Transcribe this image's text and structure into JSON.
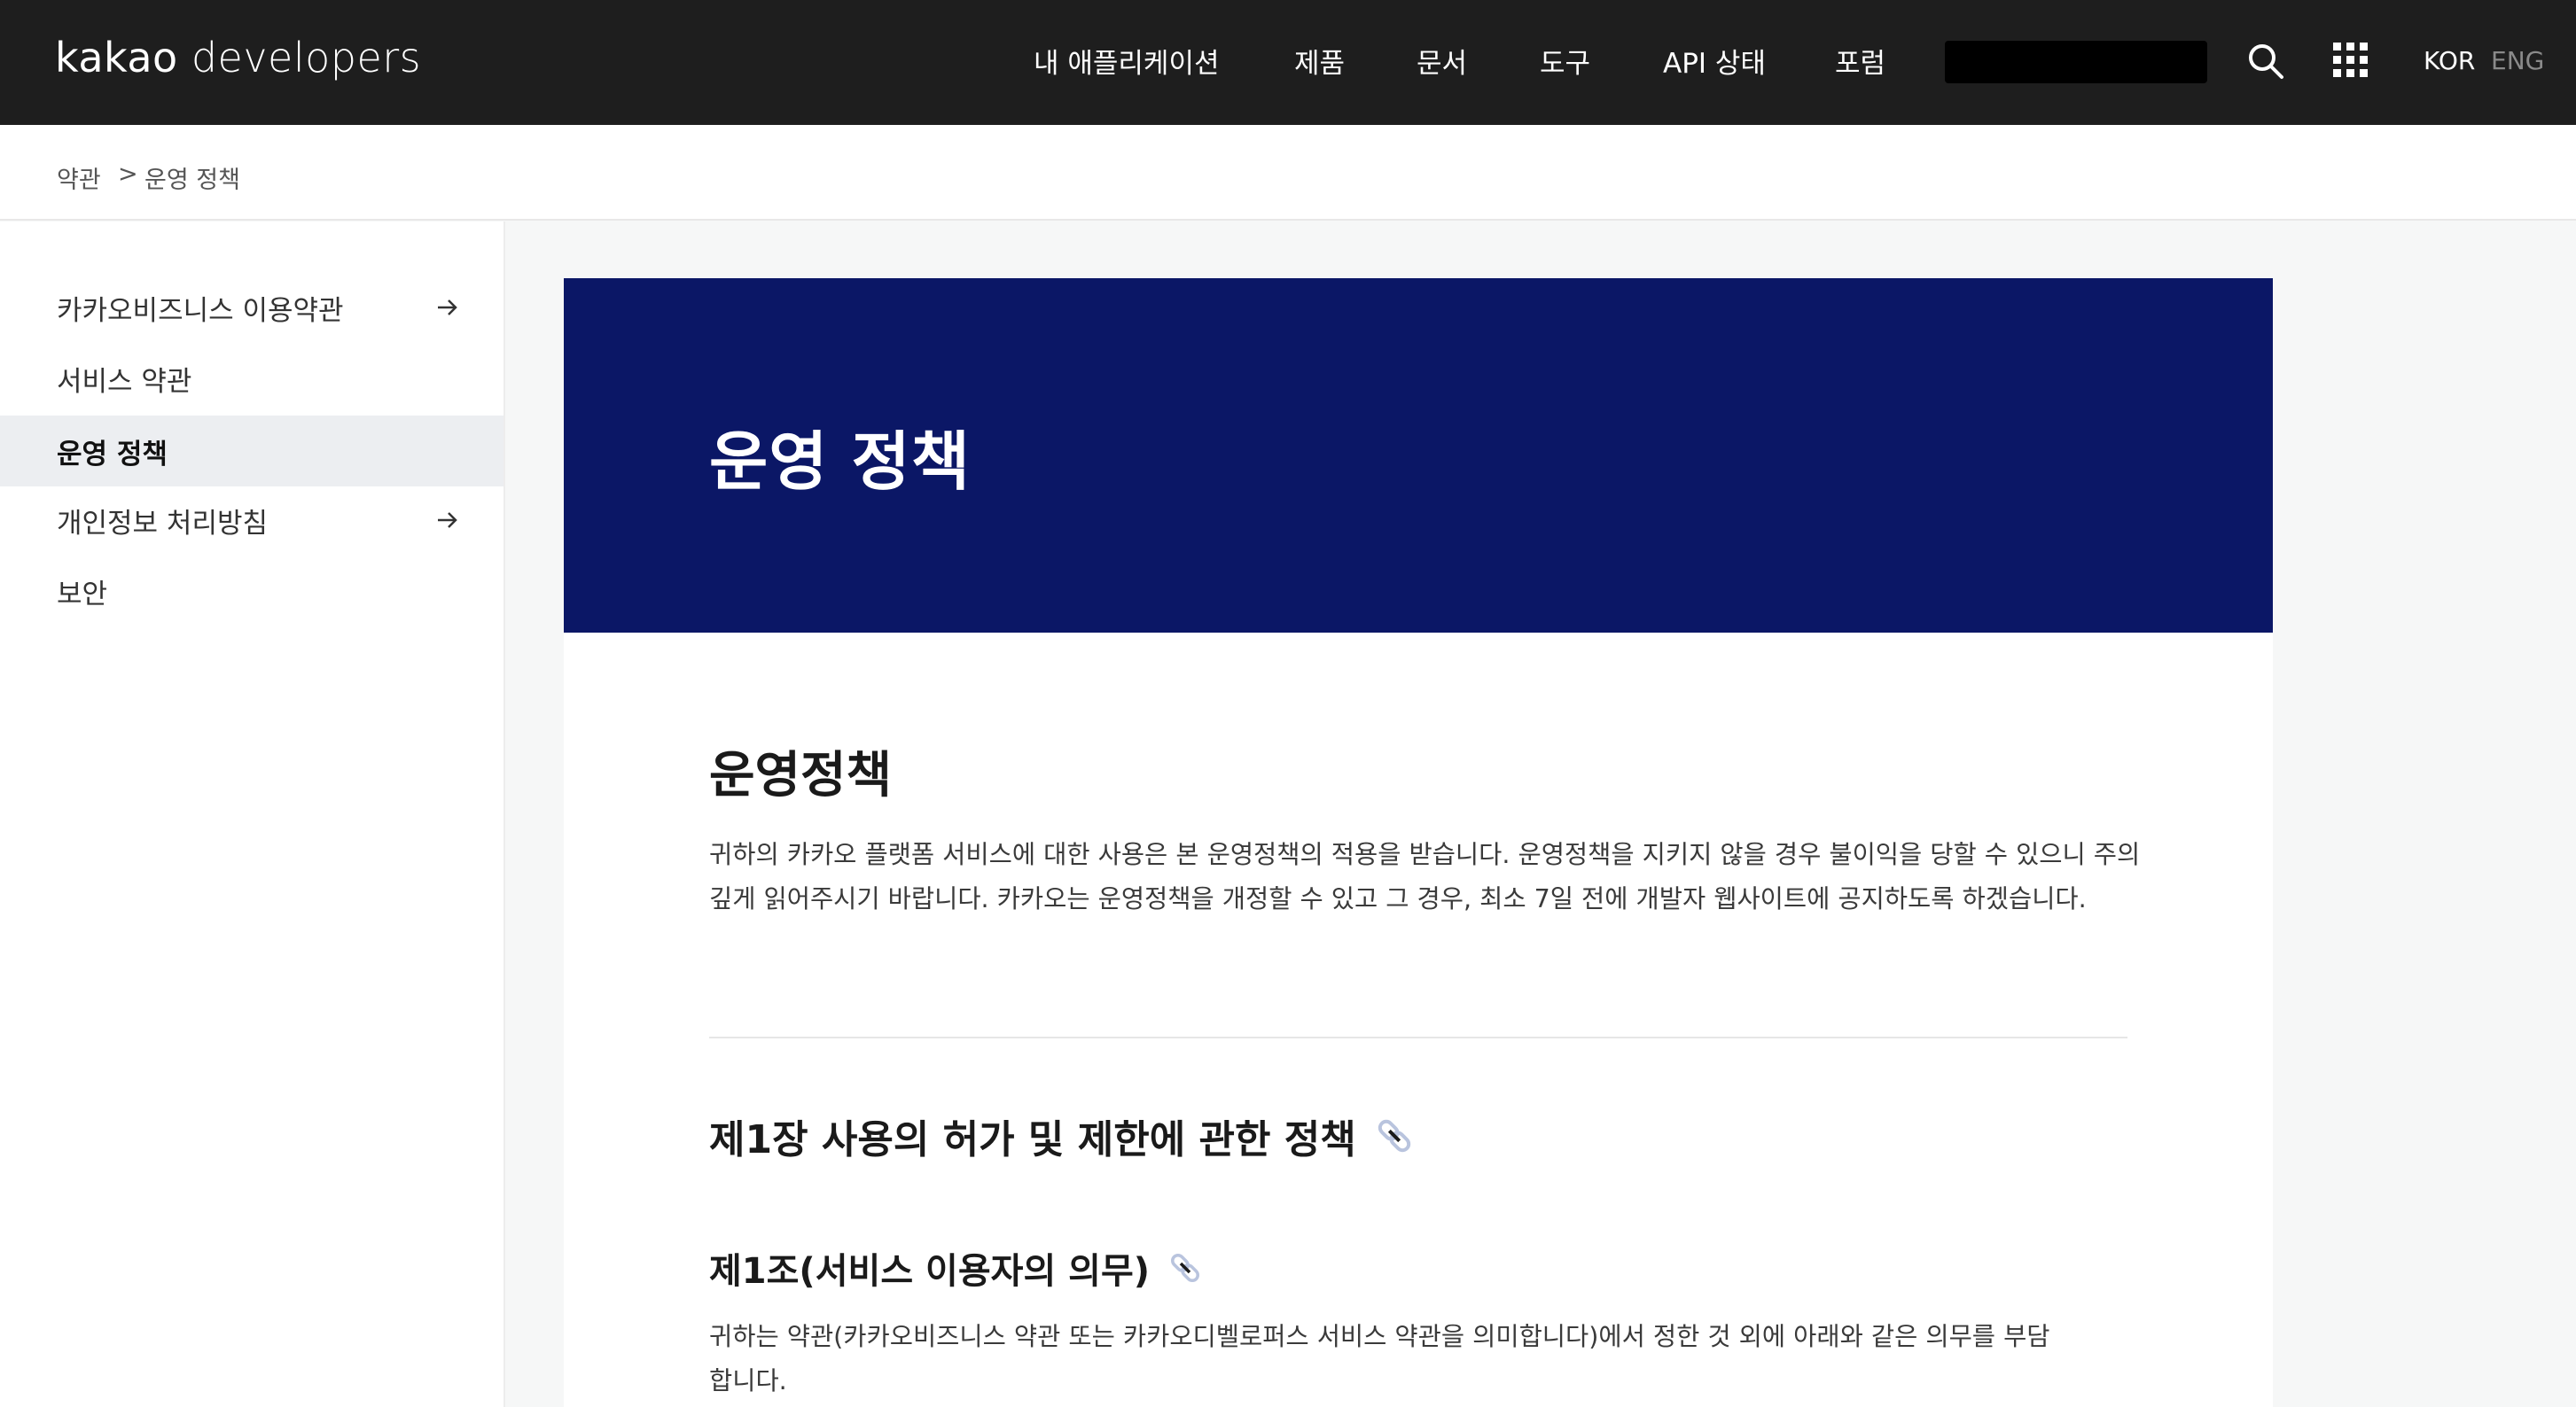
{
  "header": {
    "logo_brand": "kakao",
    "logo_suffix": "developers",
    "nav": [
      {
        "label": "내 애플리케이션"
      },
      {
        "label": "제품"
      },
      {
        "label": "문서"
      },
      {
        "label": "도구"
      },
      {
        "label": "API 상태"
      },
      {
        "label": "포럼"
      }
    ],
    "lang_kor": "KOR",
    "lang_eng": "ENG",
    "icons": {
      "search": "search-icon",
      "apps": "grid-apps-icon"
    }
  },
  "breadcrumb": {
    "root": "약관",
    "separator": ">",
    "current": "운영 정책"
  },
  "sidebar": {
    "items": [
      {
        "label": "카카오비즈니스 이용약관",
        "has_arrow": true
      },
      {
        "label": "서비스 약관",
        "has_arrow": false
      },
      {
        "label": "운영 정책",
        "has_arrow": false,
        "active": true
      },
      {
        "label": "개인정보 처리방침",
        "has_arrow": true
      },
      {
        "label": "보안",
        "has_arrow": false
      }
    ]
  },
  "hero": {
    "title": "운영 정책",
    "background": "#0b1766"
  },
  "content": {
    "heading": "운영정책",
    "intro": "귀하의 카카오 플랫폼 서비스에 대한 사용은 본 운영정책의 적용을 받습니다. 운영정책을 지키지 않을 경우 불이익을 당할 수 있으니 주의 깊게 읽어주시기 바랍니다. 카카오는 운영정책을 개정할 수 있고 그 경우, 최소 7일 전에 개발자 웹사이트에 공지하도록 하겠습니다.",
    "chapter_title": "제1장 사용의 허가 및 제한에 관한 정책",
    "article_title": "제1조(서비스 이용자의 의무)",
    "article_body": "귀하는 약관(카카오비즈니스 약관 또는 카카오디벨로퍼스 서비스 약관을 의미합니다)에서 정한 것 외에 아래와 같은 의무를 부담합니다."
  }
}
